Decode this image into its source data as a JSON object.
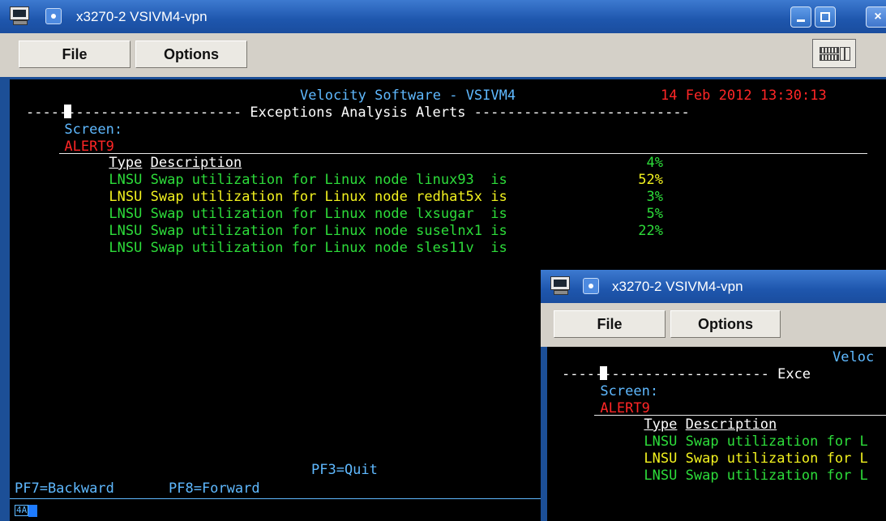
{
  "main_window": {
    "title": "x3270-2 VSIVM4-vpn",
    "menu": {
      "file": "File",
      "options": "Options"
    },
    "close_glyph": "×"
  },
  "screen": {
    "label": "Screen:",
    "name": "ALERT9",
    "vendor": "Velocity Software - VSIVM4",
    "datetime": "14 Feb 2012 13:30:13",
    "section_title": "-------------------------- Exceptions Analysis Alerts --------------------------",
    "col_type": "Type",
    "col_desc": "Description",
    "rows": [
      {
        "type": "LNSU",
        "desc": "Swap utilization for Linux node linux93  is",
        "value": "4%",
        "color": "#2ddc3a"
      },
      {
        "type": "LNSU",
        "desc": "Swap utilization for Linux node redhat5x is",
        "value": "52%",
        "color": "#f2f21f"
      },
      {
        "type": "LNSU",
        "desc": "Swap utilization for Linux node lxsugar  is",
        "value": "3%",
        "color": "#2ddc3a"
      },
      {
        "type": "LNSU",
        "desc": "Swap utilization for Linux node suselnx1 is",
        "value": "5%",
        "color": "#2ddc3a"
      },
      {
        "type": "LNSU",
        "desc": "Swap utilization for Linux node sles11v  is",
        "value": "22%",
        "color": "#2ddc3a"
      }
    ],
    "pf3": "PF3=Quit",
    "pf7": "PF7=Backward",
    "pf8": "PF8=Forward",
    "oia_indicator": "4A"
  },
  "second_window": {
    "title": "x3270-2 VSIVM4-vpn",
    "menu": {
      "file": "File",
      "options": "Options"
    },
    "screen_label": "Screen:",
    "screen_name": "ALERT9",
    "vendor_fragment": "Veloc",
    "section_fragment": "------------------------- Exce",
    "col_type": "Type",
    "col_desc": "Description",
    "rows": [
      {
        "type": "LNSU",
        "desc": "Swap utilization for L",
        "color": "#2ddc3a"
      },
      {
        "type": "LNSU",
        "desc": "Swap utilization for L",
        "color": "#f2f21f"
      },
      {
        "type": "LNSU",
        "desc": "Swap utilization for L",
        "color": "#2ddc3a"
      }
    ]
  },
  "colors": {
    "title_bar": "#1e56ad",
    "terminal_bg": "#000000",
    "green": "#2ddc3a",
    "yellow": "#f2f21f",
    "red": "#ff2626",
    "cyan": "#5fb9ff"
  }
}
